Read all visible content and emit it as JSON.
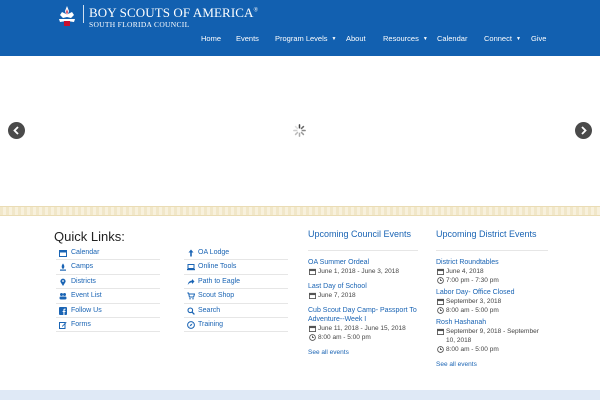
{
  "colors": {
    "header_bg": "#1260b0",
    "link": "#1a64b4",
    "band": "#f1e7c9",
    "footer_strip": "#dfe9f6"
  },
  "brand": {
    "title": "BOY SCOUTS OF AMERICA",
    "registered": "®",
    "subtitle": "SOUTH FLORIDA COUNCIL",
    "logo_icon": "fleur-de-lis-icon"
  },
  "nav": {
    "items": [
      {
        "label": "Home",
        "caret": ""
      },
      {
        "label": "Events",
        "caret": ""
      },
      {
        "label": "Program Levels",
        "caret": "▼"
      },
      {
        "label": "About",
        "caret": ""
      },
      {
        "label": "Resources",
        "caret": "▼"
      },
      {
        "label": "Calendar",
        "caret": ""
      },
      {
        "label": "Connect",
        "caret": "▼"
      },
      {
        "label": "Give",
        "caret": ""
      }
    ]
  },
  "slider": {
    "prev_icon": "chevron-left-icon",
    "next_icon": "chevron-right-icon",
    "loading_icon": "spinner-icon"
  },
  "quick_links": {
    "title": "Quick Links:",
    "column_1": [
      {
        "label": "Calendar",
        "icon": "calendar-icon"
      },
      {
        "label": "Camps",
        "icon": "campfire-icon"
      },
      {
        "label": "Districts",
        "icon": "map-marker-icon"
      },
      {
        "label": "Event List",
        "icon": "users-icon"
      },
      {
        "label": "Follow Us",
        "icon": "facebook-icon"
      },
      {
        "label": "Forms",
        "icon": "edit-icon"
      }
    ],
    "column_2": [
      {
        "label": "OA Lodge",
        "icon": "arrow-up-icon"
      },
      {
        "label": "Online Tools",
        "icon": "laptop-icon"
      },
      {
        "label": "Path to Eagle",
        "icon": "share-icon"
      },
      {
        "label": "Scout Shop",
        "icon": "shopping-cart-icon"
      },
      {
        "label": "Search",
        "icon": "search-icon"
      },
      {
        "label": "Training",
        "icon": "compass-icon"
      }
    ]
  },
  "council_events": {
    "heading": "Upcoming Council Events",
    "items": [
      {
        "title": "OA Summer Ordeal",
        "date": "June 1, 2018 - June 3, 2018",
        "time": ""
      },
      {
        "title": "Last Day of School",
        "date": "June 7, 2018",
        "time": ""
      },
      {
        "title": "Cub Scout Day Camp- Passport To Adventure--Week I",
        "date": "June 11, 2018 - June 15, 2018",
        "time": "8:00 am - 5:00 pm"
      }
    ],
    "see_all": "See all events"
  },
  "district_events": {
    "heading": "Upcoming District Events",
    "items": [
      {
        "title": "District Roundtables",
        "date": "June 4, 2018",
        "time": "7:00 pm - 7:30 pm"
      },
      {
        "title": "Labor Day- Office Closed",
        "date": "September 3, 2018",
        "time": "8:00 am - 5:00 pm"
      },
      {
        "title": "Rosh Hashanah",
        "date": "September 9, 2018 - September 10, 2018",
        "time": "8:00 am - 5:00 pm"
      }
    ],
    "see_all": "See all events"
  }
}
